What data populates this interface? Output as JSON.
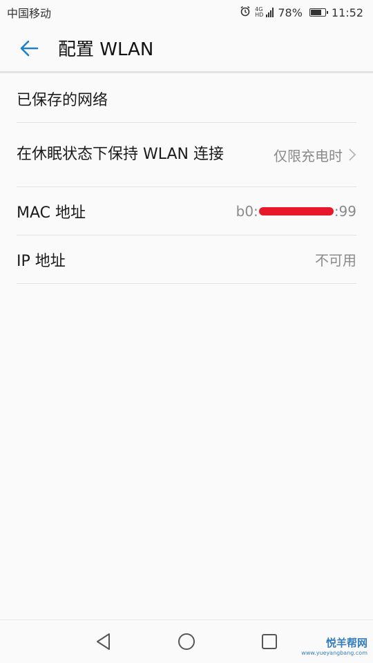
{
  "status_bar": {
    "carrier": "中国移动",
    "network_top": "4G",
    "network_bottom": "HD",
    "battery": "78%",
    "battery_level": 0.78,
    "time": "11:52"
  },
  "header": {
    "title": "配置 WLAN"
  },
  "settings": {
    "saved_networks": {
      "label": "已保存的网络"
    },
    "keep_wlan_on_sleep": {
      "label": "在休眠状态下保持 WLAN 连接",
      "value": "仅限充电时"
    },
    "mac_address": {
      "label": "MAC 地址",
      "value_prefix": "b0:",
      "value_suffix": ":99"
    },
    "ip_address": {
      "label": "IP 地址",
      "value": "不可用"
    }
  },
  "watermark": {
    "title": "悦羊帮网",
    "url": "www.yueyangbang.com"
  },
  "colors": {
    "accent": "#1d7fc4",
    "background": "#fafafa",
    "secondary_text": "#8a8a8a",
    "redaction": "#e8182a"
  },
  "icons": {
    "back": "arrow-left-icon",
    "chevron": "chevron-right-icon",
    "alarm": "alarm-clock-icon",
    "signal": "signal-icon",
    "battery": "battery-icon",
    "nav_back": "triangle-back-icon",
    "nav_home": "circle-home-icon",
    "nav_recent": "square-recent-icon"
  }
}
